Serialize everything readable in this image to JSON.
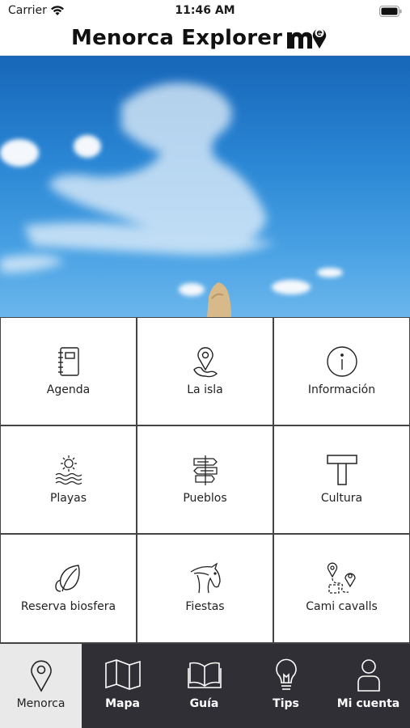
{
  "status_bar": {
    "carrier": "Carrier",
    "time": "11:46 AM"
  },
  "header": {
    "title": "Menorca Explorer",
    "logo_icon": "menorca-explorer-logo-icon"
  },
  "grid": {
    "items": [
      {
        "label": "Agenda",
        "icon": "notebook-icon"
      },
      {
        "label": "La isla",
        "icon": "map-pin-icon"
      },
      {
        "label": "Información",
        "icon": "info-icon"
      },
      {
        "label": "Playas",
        "icon": "sun-waves-icon"
      },
      {
        "label": "Pueblos",
        "icon": "signpost-icon"
      },
      {
        "label": "Cultura",
        "icon": "taula-icon"
      },
      {
        "label": "Reserva biosfera",
        "icon": "leaf-icon"
      },
      {
        "label": "Fiestas",
        "icon": "horse-icon"
      },
      {
        "label": "Cami cavalls",
        "icon": "route-icon"
      }
    ]
  },
  "tabbar": {
    "tabs": [
      {
        "label": "Menorca",
        "icon": "location-pin-icon",
        "active": true
      },
      {
        "label": "Mapa",
        "icon": "map-icon",
        "active": false
      },
      {
        "label": "Guía",
        "icon": "book-icon",
        "active": false
      },
      {
        "label": "Tips",
        "icon": "lightbulb-icon",
        "active": false
      },
      {
        "label": "Mi cuenta",
        "icon": "user-icon",
        "active": false
      }
    ]
  },
  "colors": {
    "tabbar_bg": "#2f2f35",
    "active_tab_bg": "#e9e9ea",
    "sky": "#2a86d4"
  }
}
